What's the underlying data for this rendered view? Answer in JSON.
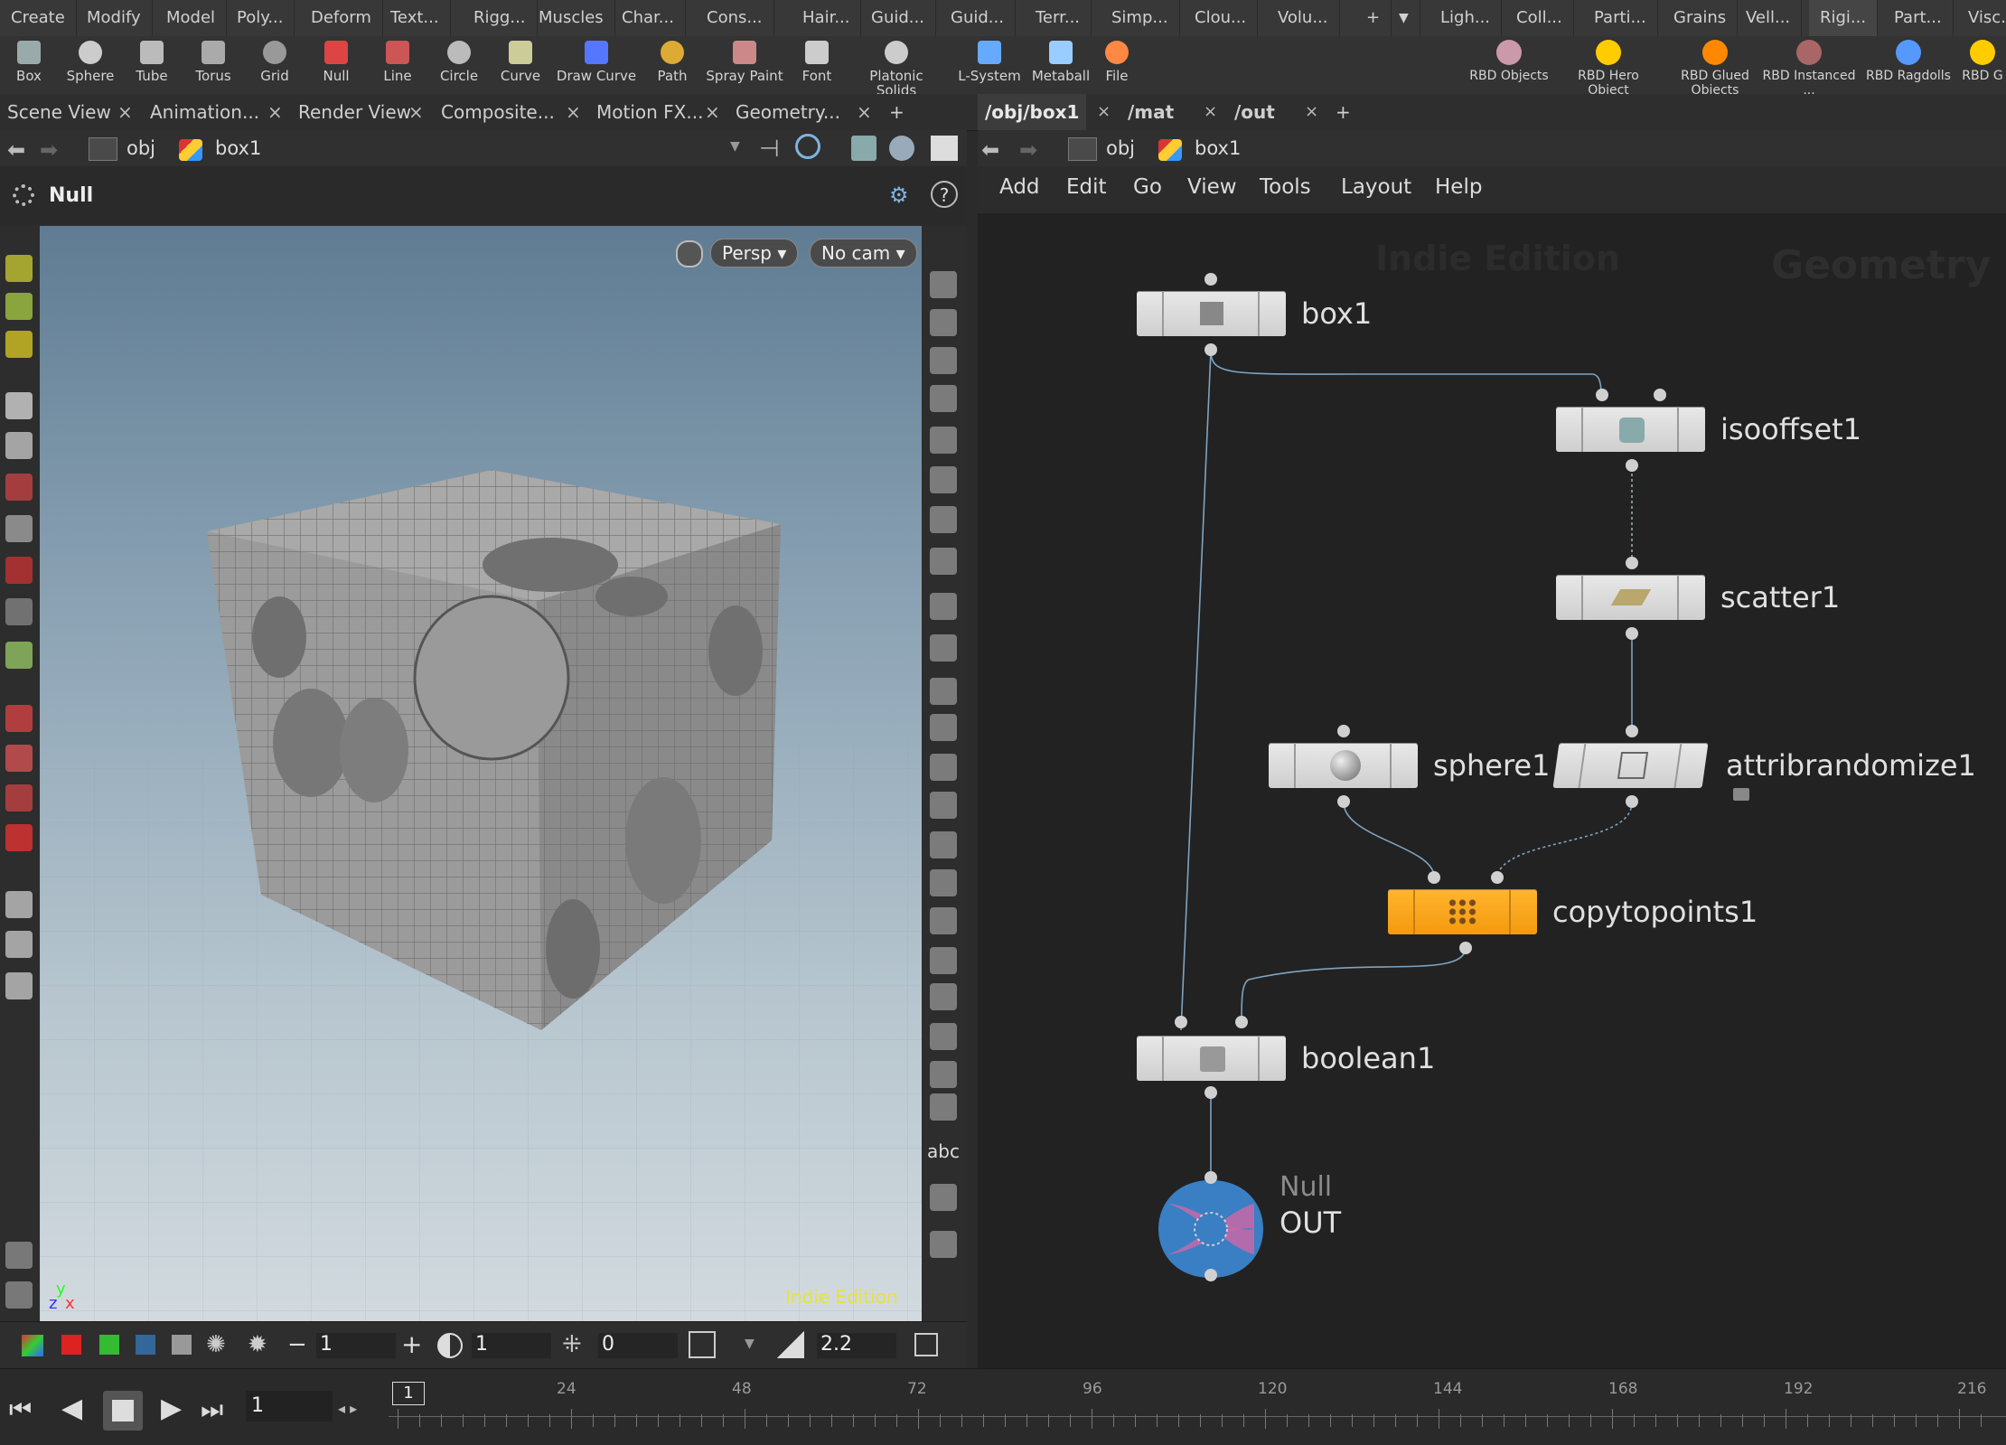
{
  "shelf_tabs": {
    "left": [
      "Create",
      "Modify",
      "Model",
      "Poly...",
      "Deform",
      "Text...",
      "Rigg...",
      "Muscles",
      "Char...",
      "Cons...",
      "Hair...",
      "Guid...",
      "Guid...",
      "Terr...",
      "Simp...",
      "Clou...",
      "Volu..."
    ],
    "right": [
      "Ligh...",
      "Coll...",
      "Parti...",
      "Grains",
      "Vell...",
      "Rigi...",
      "Part...",
      "Visc..."
    ],
    "add_icon": "+",
    "dropdown_icon": "▼"
  },
  "shelf_tools": {
    "left": [
      "Box",
      "Sphere",
      "Tube",
      "Torus",
      "Grid",
      "Null",
      "Line",
      "Circle",
      "Curve",
      "Draw Curve",
      "Path",
      "Spray Paint",
      "Font",
      "Platonic Solids",
      "L-System",
      "Metaball",
      "File"
    ],
    "right": [
      "RBD Objects",
      "RBD Hero Object",
      "RBD Glued Objects",
      "RBD Instanced ...",
      "RBD Ragdolls",
      "RBD G"
    ]
  },
  "pane_tabs": {
    "left": [
      "Scene View",
      "Animation...",
      "Render View",
      "Composite...",
      "Motion FX...",
      "Geometry..."
    ],
    "right": [
      "/obj/box1",
      "/mat",
      "/out"
    ],
    "close": "×",
    "add": "+"
  },
  "viewer": {
    "path_obj": "obj",
    "path_node": "box1",
    "header_title": "Null",
    "persp_label": "Persp",
    "cam_label": "No cam",
    "watermark": "Indie Edition",
    "axis_y": "y",
    "axis_z": "z",
    "axis_x": "x",
    "abc_label": "abc",
    "bottom": {
      "value1": "1",
      "value2": "1",
      "value3": "0",
      "value4": "2.2",
      "minus": "−",
      "plus": "+"
    }
  },
  "network": {
    "path_obj": "obj",
    "path_node": "box1",
    "menu": [
      "Add",
      "Edit",
      "Go",
      "View",
      "Tools",
      "Layout",
      "Help"
    ],
    "bg_watermark": "Indie Edition",
    "bg_context": "Geometry",
    "nodes": {
      "box1": "box1",
      "isooffset1": "isooffset1",
      "scatter1": "scatter1",
      "sphere1": "sphere1",
      "attribrandomize1": "attribrandomize1",
      "copytopoints1": "copytopoints1",
      "boolean1": "boolean1",
      "null_type": "Null",
      "null_name": "OUT"
    },
    "colors": {
      "copytopoints": "#f5a623",
      "wire": "#7fa3c0",
      "null_blue": "#3a7fc4",
      "null_pink": "#c06aa8"
    }
  },
  "timeline": {
    "current_frame": "1",
    "marker": "1",
    "ticks": [
      "24",
      "48",
      "72",
      "96",
      "120",
      "144",
      "168",
      "192",
      "216"
    ]
  }
}
